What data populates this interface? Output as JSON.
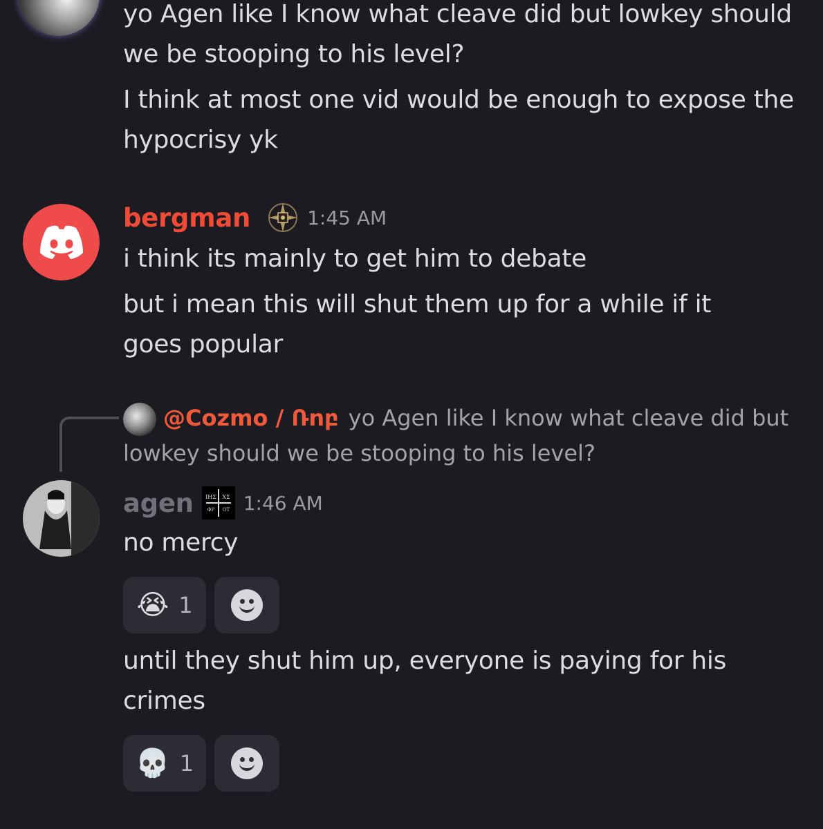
{
  "messages_top": {
    "lines": [
      "yo Agen like I know what cleave did but lowkey should we be stooping to his level?",
      "I think at most one vid would be enough to expose the hypocrisy yk"
    ]
  },
  "bergman": {
    "username": "bergman",
    "username_color": "#ef4b36",
    "timestamp": "1:45 AM",
    "lines": [
      "i think its mainly to get him to debate",
      "but i mean this will shut them up for a while if it goes popular"
    ]
  },
  "reply": {
    "user": "@Cozmo / Ռnբ",
    "text": "yo Agen like I know what cleave did but lowkey should we be stooping to his level?"
  },
  "agen": {
    "username": "agen",
    "timestamp": "1:46 AM",
    "badge_text": "ΙΗΣ ΧΡΣ",
    "lines": [
      "no mercy",
      "until they shut him up, everyone is paying for his crimes"
    ]
  },
  "reactions": {
    "first": {
      "emoji": "😭",
      "count": "1"
    },
    "second": {
      "emoji": "💀",
      "count": "1"
    }
  }
}
